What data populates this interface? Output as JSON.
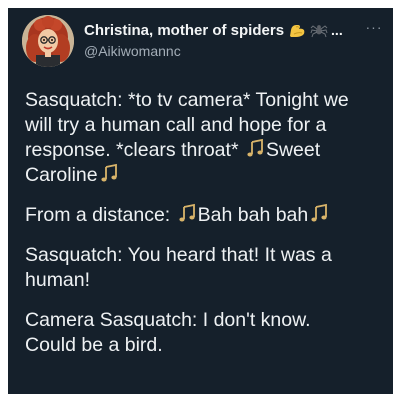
{
  "tweet": {
    "display_name": "Christina, mother of spiders",
    "name_ellipsis": "...",
    "handle": "@Aikiwomannc",
    "more_label": "···",
    "icons": [
      "avatar",
      "flexed-biceps-emoji",
      "spider-emoji",
      "more-icon",
      "music-note-icon"
    ],
    "colors": {
      "background": "#15202b",
      "text": "#eef1f3",
      "secondary_text": "#a3adb7",
      "note_gold": "#d9b46a"
    },
    "paragraphs": [
      {
        "lines": [
          [
            "Sasquatch: *to tv camera* Tonight  we"
          ],
          [
            "will try a human call and hope for a"
          ],
          [
            "response. *clears throat* ",
            "♫",
            "Sweet"
          ],
          [
            "Caroline",
            "♫"
          ]
        ]
      },
      {
        "lines": [
          [
            "From a distance: ",
            "♫",
            "Bah bah bah",
            "♫"
          ]
        ]
      },
      {
        "lines": [
          [
            "Sasquatch: You heard that! It was a"
          ],
          [
            "human!"
          ]
        ]
      },
      {
        "lines": [
          [
            "Camera Sasquatch: I don't know."
          ],
          [
            "Could be a bird."
          ]
        ]
      }
    ]
  }
}
